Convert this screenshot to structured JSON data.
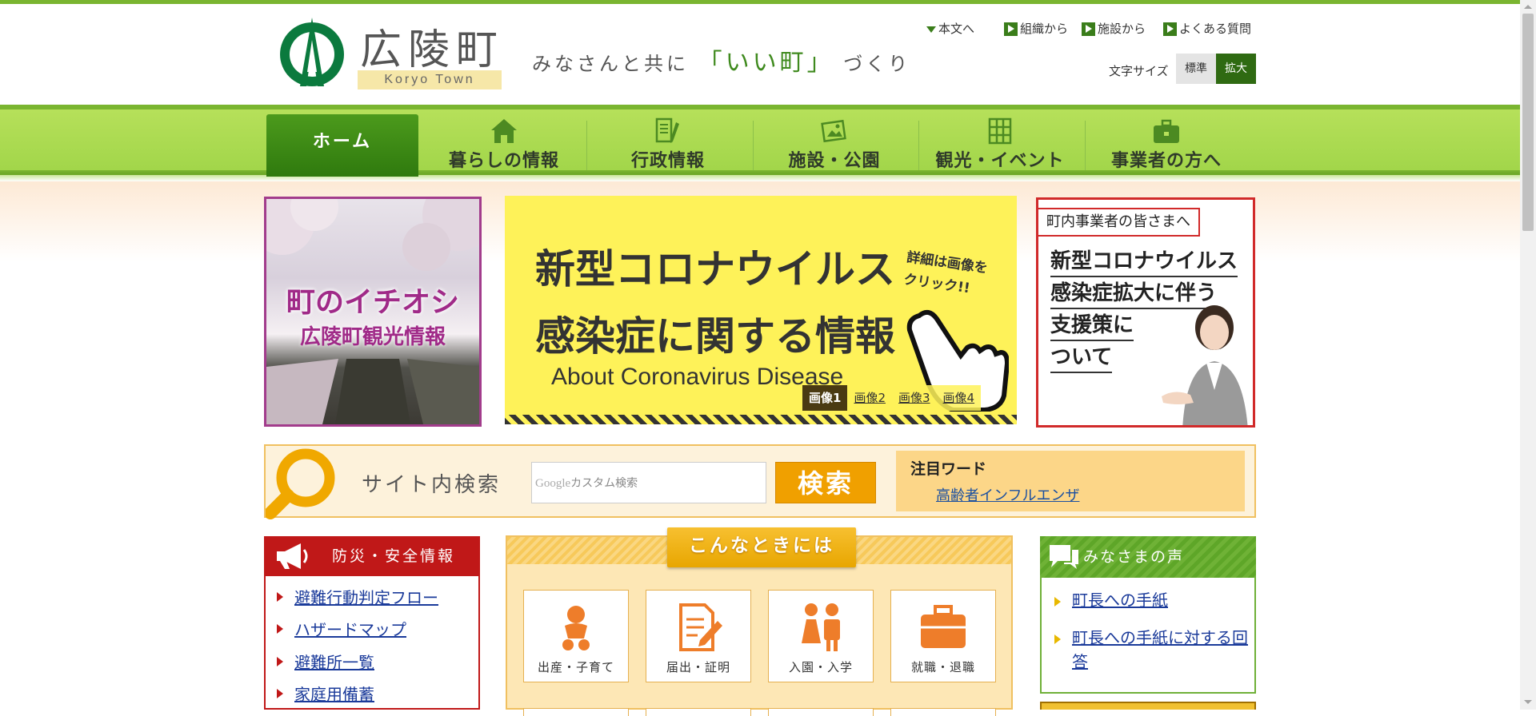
{
  "header": {
    "logo_name": "広陵町",
    "logo_en": "Koryo Town",
    "tagline_pre": "みなさんと共に",
    "tagline_em": "「いい町」",
    "tagline_post": "づくり",
    "util_links": [
      "本文へ",
      "組織から",
      "施設から",
      "よくある質問"
    ],
    "font_size_label": "文字サイズ",
    "font_size_options": [
      "標準",
      "拡大"
    ]
  },
  "nav": {
    "items": [
      "ホーム",
      "暮らしの情報",
      "行政情報",
      "施設・公園",
      "観光・イベント",
      "事業者の方へ"
    ]
  },
  "banners": {
    "left_line1": "町のイチオシ",
    "left_line2": "広陵町観光情報",
    "main_line1": "新型コロナウイルス",
    "main_line2": "感染症に関する情報",
    "main_line3": "About Coronavirus Disease",
    "main_detail1": "詳細は画像を",
    "main_detail2": "クリック!!",
    "slides": [
      "画像1",
      "画像2",
      "画像3",
      "画像4"
    ],
    "right_head": "町内事業者の皆さまへ",
    "right_lines": [
      "新型コロナウイルス",
      "感染症拡大に伴う",
      "支援策に",
      "ついて"
    ]
  },
  "search": {
    "label": "サイト内検索",
    "placeholder_brand": "Google",
    "placeholder": "カスタム検索",
    "button": "検索",
    "attention_title": "注目ワード",
    "attention_link": "高齢者インフルエンザ"
  },
  "bosai": {
    "title": "防災・安全情報",
    "items": [
      "避難行動判定フロー",
      "ハザードマップ",
      "避難所一覧",
      "家庭用備蓄"
    ]
  },
  "konna": {
    "title": "こんなときには",
    "cards": [
      "出産・子育て",
      "届出・証明",
      "入園・入学",
      "就職・退職"
    ]
  },
  "voice": {
    "title": "みなさまの声",
    "items": [
      "町長への手紙",
      "町長への手紙に対する回答"
    ]
  },
  "colors": {
    "brand_green": "#3a7d1a",
    "nav_green": "#a2d64a",
    "bosai_red": "#c01818",
    "search_orange": "#f0a000"
  }
}
